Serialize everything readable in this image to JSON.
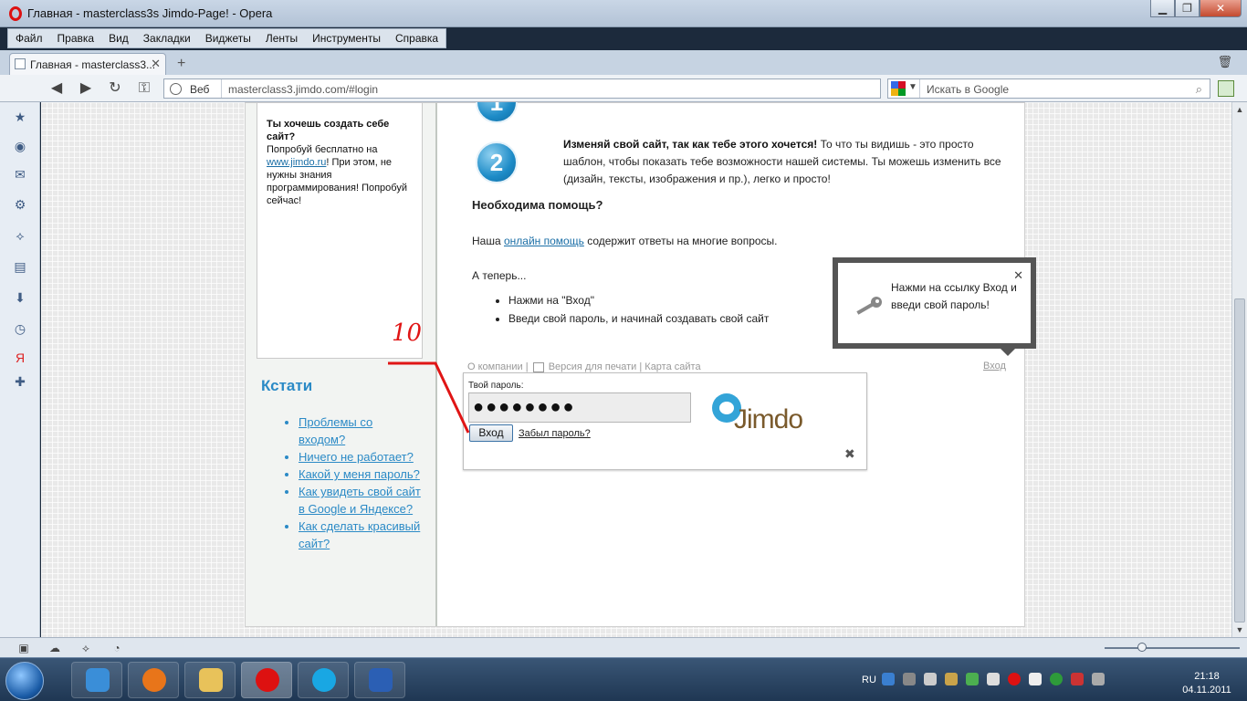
{
  "window": {
    "title": "Главная - masterclass3s Jimdo-Page! - Opera",
    "min": "▁",
    "max": "❐",
    "close": "✕"
  },
  "menu": [
    "Файл",
    "Правка",
    "Вид",
    "Закладки",
    "Виджеты",
    "Ленты",
    "Инструменты",
    "Справка"
  ],
  "tab": {
    "label": "Главная - masterclass3...",
    "close": "✕",
    "new": "+"
  },
  "nav": {
    "back": "◀",
    "forward": "▶",
    "reload": "↻",
    "key": "⚿",
    "web_label": "Веб",
    "url": "masterclass3.jimdo.com/#login",
    "search_placeholder": "Искать в Google",
    "search_icon": "⌕"
  },
  "sidebar_icons": [
    "star-icon",
    "speed-dial-icon",
    "mail-icon",
    "settings-icon",
    "share-icon",
    "notes-icon",
    "downloads-icon",
    "history-icon",
    "yandex-icon",
    "add-icon"
  ],
  "promo": {
    "title": "Ты хочешь создать себе сайт?",
    "text_before": "Попробуй бесплатно на ",
    "link": "www.jimdo.ru",
    "text_after": "! При этом, не нужны знания программирования! Попробуй сейчас!"
  },
  "kstati": {
    "heading": "Кстати",
    "items": [
      "Проблемы со входом?",
      "Ничего не работает?",
      "Какой у меня пароль?",
      "Как увидеть свой сайт в Google и Яндексе?",
      "Как сделать красивый сайт?"
    ]
  },
  "main": {
    "step_number": "2",
    "step_title": "Изменяй свой сайт, так как тебе этого хочется!",
    "step_text": " То что ты видишь - это просто шаблон, чтобы показать тебе возможности нашей системы. Ты можешь изменить все (дизайн, тексты, изображения и пр.), легко и просто!",
    "help_heading": "Необходима помощь?",
    "help_before": "Наша ",
    "help_link": "онлайн помощь",
    "help_after": " содержит ответы на многие вопросы.",
    "now": "А теперь...",
    "now_items": [
      "Нажми на \"Вход\"",
      "Введи свой пароль, и начинай создавать свой сайт"
    ]
  },
  "footer": {
    "about": "О компании",
    "print": "Версия для печати",
    "sitemap": "Карта сайта",
    "login": "Вход"
  },
  "login": {
    "label": "Твой пароль:",
    "password_mask": "●●●●●●●●",
    "button": "Вход",
    "forgot": "Забыл пароль?",
    "close": "✖",
    "logo_text": "Jimdo"
  },
  "tooltip": {
    "text": "Нажми на ссылку Вход и введи свой пароль!",
    "close": "✕"
  },
  "annotation": {
    "number": "10"
  },
  "taskbar": {
    "lang": "RU",
    "time": "21:18",
    "date": "04.11.2011"
  },
  "colors": {
    "link": "#2b8ac6",
    "annotation": "#e01515",
    "jimdo_blue": "#33a4d8",
    "jimdo_brown": "#7a5a2c"
  }
}
